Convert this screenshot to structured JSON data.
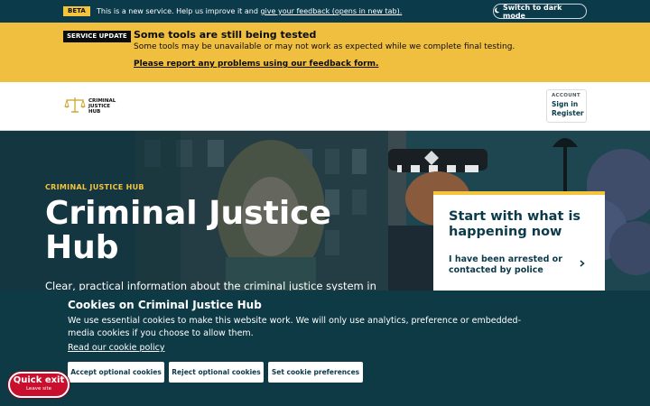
{
  "beta_bar": {
    "tag": "BETA",
    "text": "This is a new service. Help us improve it and",
    "link": "give your feedback (opens in new tab).",
    "dark_mode_icon": "moon-icon",
    "dark_mode_label": "Switch to dark mode"
  },
  "service_update": {
    "tag": "SERVICE UPDATE",
    "title": "Some tools are still being tested",
    "body": "Some tools may be unavailable or may not work as expected while we complete final testing.",
    "link": "Please report any problems using our feedback form."
  },
  "header": {
    "logo_icon": "scales-of-justice-icon",
    "logo_line1": "CRIMINAL",
    "logo_line2": "JUSTICE",
    "logo_line3": "HUB",
    "account_label": "ACCOUNT",
    "sign_in": "Sign in",
    "register": "Register"
  },
  "hero": {
    "kicker": "CRIMINAL JUSTICE HUB",
    "title": "Criminal Justice Hub",
    "description": "Clear, practical information about the criminal justice system in",
    "start_card": {
      "title": "Start with what is happening now",
      "option_label": "I have been arrested or contacted by police",
      "option_icon": "chevron-right-icon"
    }
  },
  "cookie_banner": {
    "title": "Cookies on Criminal Justice Hub",
    "body": "We use essential cookies to make this website work. We will only use analytics, preference or embedded-media cookies if you choose to allow them.",
    "policy_link": "Read our cookie policy",
    "accept": "Accept optional cookies",
    "reject": "Reject optional cookies",
    "preferences": "Set cookie preferences"
  },
  "quick_exit": {
    "label": "Quick exit",
    "sub": "Leave site"
  },
  "colors": {
    "brand_dark": "#0b3a4a",
    "accent_yellow": "#f2c53d",
    "service_yellow": "#f0bf3f",
    "exit_red": "#c8102e"
  }
}
